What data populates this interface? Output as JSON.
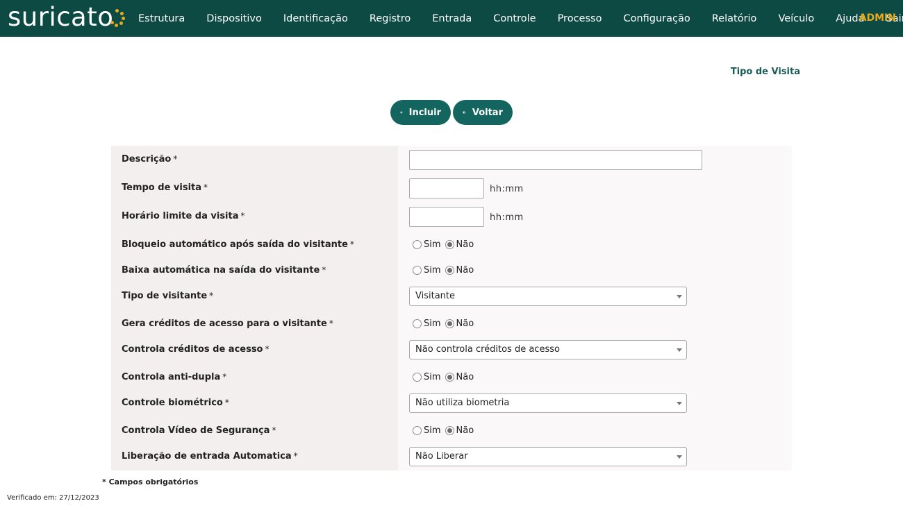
{
  "header": {
    "logo_text": "suricato",
    "nav": [
      "Estrutura",
      "Dispositivo",
      "Identificação",
      "Registro",
      "Entrada",
      "Controle",
      "Processo",
      "Configuração",
      "Relatório",
      "Veículo",
      "Ajuda",
      "Sair"
    ],
    "user": "ADMIN",
    "colors": {
      "bar": "#0d4a44",
      "accent": "#e8a91b"
    }
  },
  "page": {
    "title": "Tipo de Visita"
  },
  "actions": {
    "incluir": "Incluir",
    "voltar": "Voltar"
  },
  "form": {
    "required_mark": "*",
    "descricao": {
      "label": "Descrição",
      "value": ""
    },
    "tempo_visita": {
      "label": "Tempo de visita",
      "value": "",
      "suffix": "hh:mm"
    },
    "horario_limite": {
      "label": "Horário limite da visita",
      "value": "",
      "suffix": "hh:mm"
    },
    "bloqueio_automatico": {
      "label": "Bloqueio automático após saída do visitante",
      "options": [
        "Sim",
        "Não"
      ],
      "selected": "Não"
    },
    "baixa_automatica": {
      "label": "Baixa automática na saída do visitante",
      "options": [
        "Sim",
        "Não"
      ],
      "selected": "Não"
    },
    "tipo_visitante": {
      "label": "Tipo de visitante",
      "value": "Visitante"
    },
    "gera_creditos": {
      "label": "Gera créditos de acesso para o visitante",
      "options": [
        "Sim",
        "Não"
      ],
      "selected": "Não"
    },
    "controla_creditos": {
      "label": "Controla créditos de acesso",
      "value": "Não controla créditos de acesso"
    },
    "anti_dupla": {
      "label": "Controla anti-dupla",
      "options": [
        "Sim",
        "Não"
      ],
      "selected": "Não"
    },
    "biometrico": {
      "label": "Controle biométrico",
      "value": "Não utiliza biometria"
    },
    "video_seguranca": {
      "label": "Controla Vídeo de Segurança",
      "options": [
        "Sim",
        "Não"
      ],
      "selected": "Não"
    },
    "liberacao_entrada": {
      "label": "Liberação de entrada Automatica",
      "value": "Não Liberar"
    }
  },
  "footer": {
    "required_note": "* Campos obrigatórios",
    "verified": "Verificado em: 27/12/2023"
  }
}
